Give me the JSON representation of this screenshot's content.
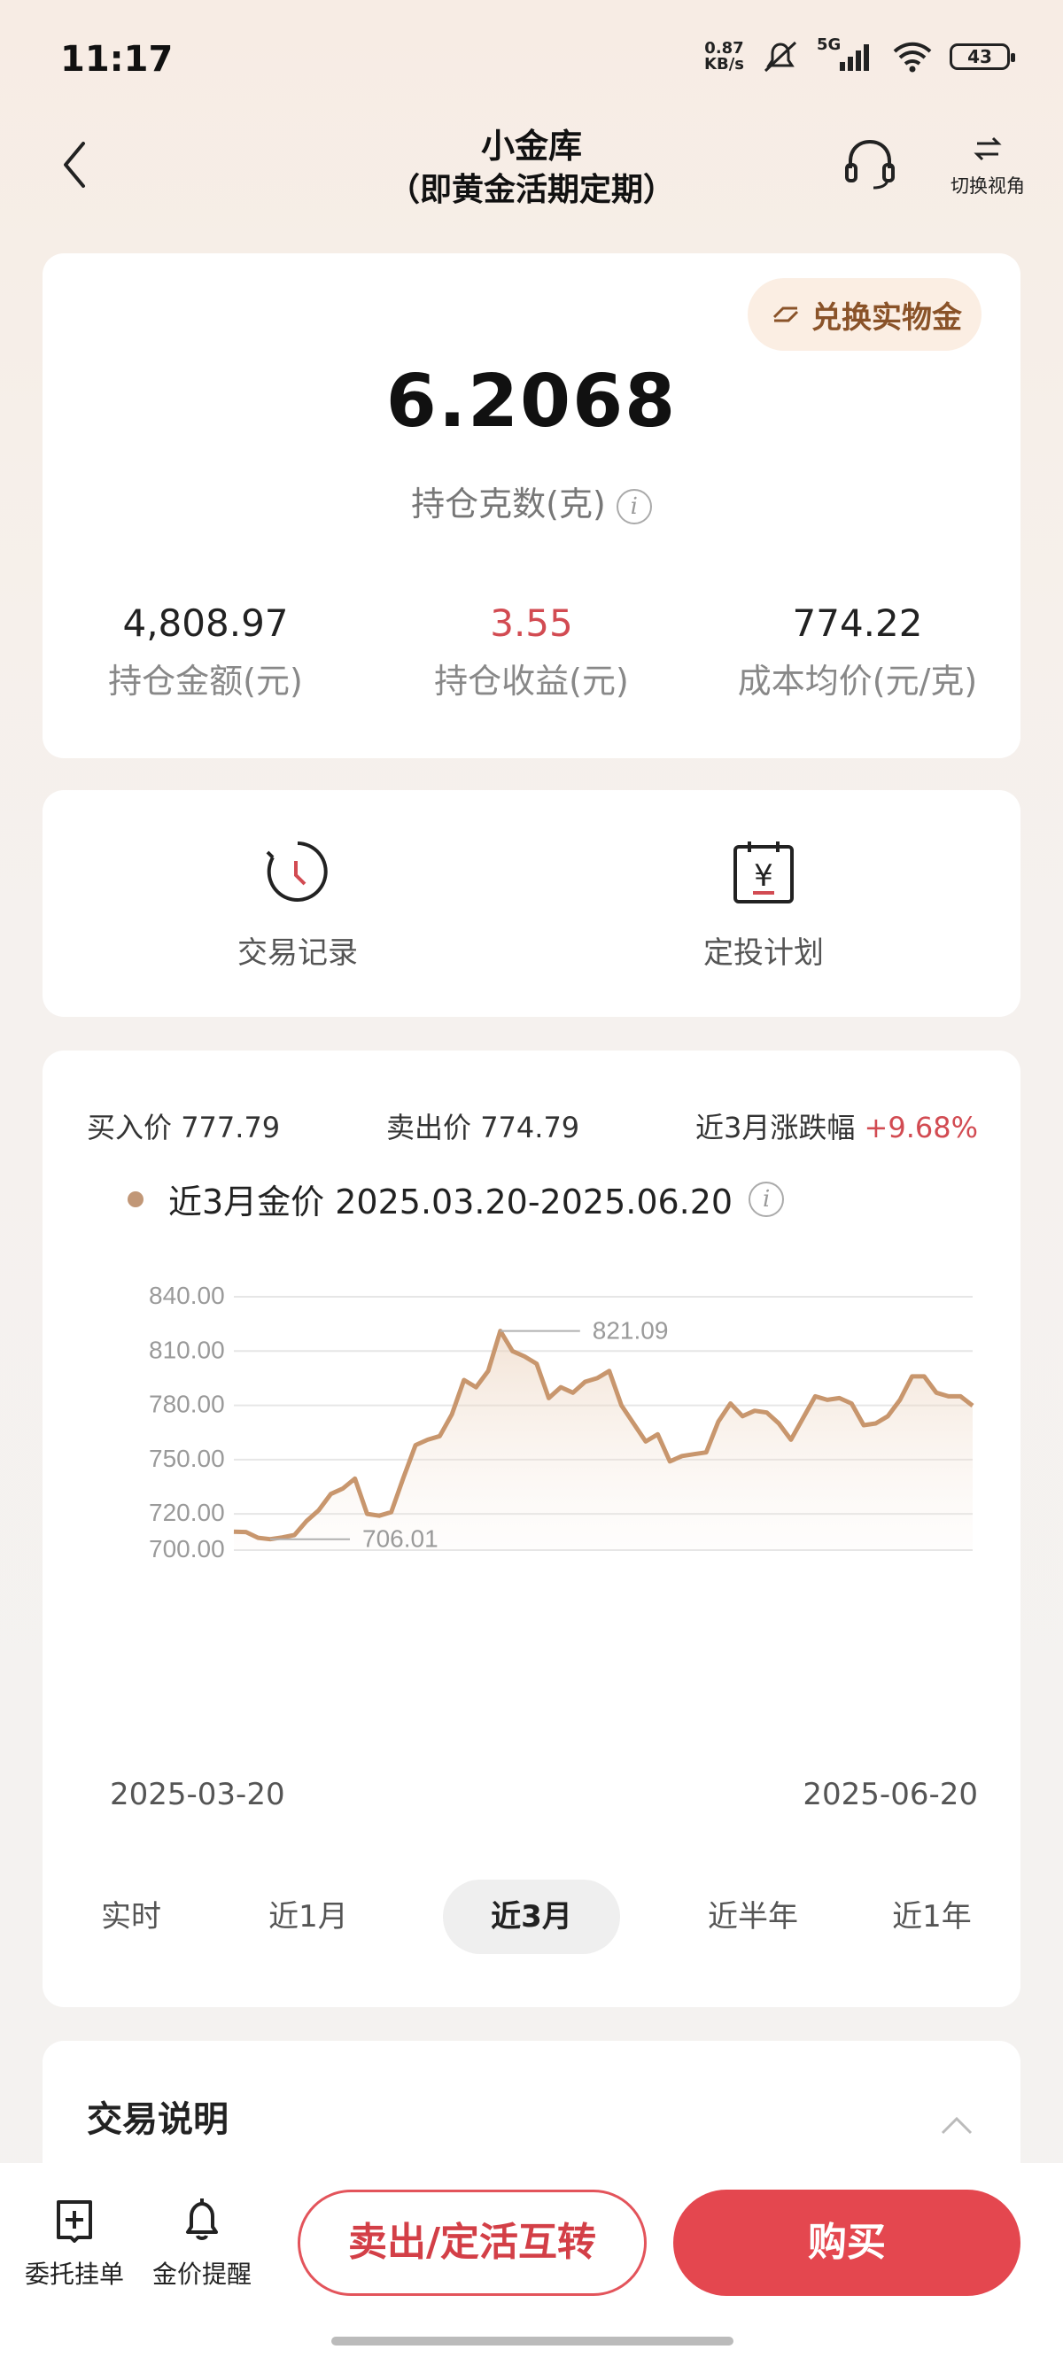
{
  "status_bar": {
    "time": "11:17",
    "net_speed_value": "0.87",
    "net_speed_unit": "KB/s",
    "network": "5G",
    "battery": "43"
  },
  "header": {
    "title": "小金库",
    "subtitle": "（即黄金活期定期）",
    "switch_view_label": "切换视角"
  },
  "holdings": {
    "exchange_button": "兑换实物金",
    "grams": "6.2068",
    "grams_label": "持仓克数(克)",
    "stats": [
      {
        "value": "4,808.97",
        "label": "持仓金额(元)"
      },
      {
        "value": "3.55",
        "label": "持仓收益(元)"
      },
      {
        "value": "774.22",
        "label": "成本均价(元/克)"
      }
    ]
  },
  "quick_actions": [
    {
      "label": "交易记录",
      "icon": "clock-history-icon"
    },
    {
      "label": "定投计划",
      "icon": "yuan-calendar-icon"
    }
  ],
  "market": {
    "buy_price_label": "买入价",
    "buy_price": "777.79",
    "sell_price_label": "卖出价",
    "sell_price": "774.79",
    "change_label": "近3月涨跌幅",
    "change_value": "+9.68%",
    "range_title": "近3月金价 2025.03.20-2025.06.20",
    "start_date": "2025-03-20",
    "end_date": "2025-06-20",
    "tabs": [
      "实时",
      "近1月",
      "近3月",
      "近半年",
      "近1年"
    ],
    "active_tab": 2
  },
  "chart_data": {
    "type": "area",
    "y_ticks": [
      "840.00",
      "810.00",
      "780.00",
      "750.00",
      "720.00",
      "700.00"
    ],
    "ylim": [
      700,
      840
    ],
    "x_range": [
      "2025-03-20",
      "2025-06-20"
    ],
    "max_label": "821.09",
    "min_label": "706.01",
    "series": [
      {
        "values": [
          710.2,
          710.0,
          706.8,
          706.0,
          707.0,
          708.3,
          716.0,
          722.0,
          731.0,
          734.0,
          739.5,
          720.0,
          719.0,
          721.0,
          740.0,
          758.0,
          761.0,
          763.0,
          775.0,
          794.0,
          790.0,
          799.0,
          821.09,
          810.0,
          807.0,
          803.0,
          784.0,
          790.0,
          787.0,
          793.0,
          795.0,
          799.0,
          780.0,
          770.0,
          760.0,
          764.0,
          749.0,
          752.0,
          753.0,
          754.0,
          771.0,
          781.0,
          774.0,
          777.0,
          776.0,
          770.0,
          761.0,
          773.0,
          785.0,
          783.0,
          784.0,
          781.0,
          769.0,
          770.0,
          774.0,
          783.0,
          796.0,
          796.0,
          787.0,
          785.0,
          785.0,
          779.79
        ],
        "color": "#c8966d"
      }
    ],
    "grid": true
  },
  "explain": {
    "title": "交易说明"
  },
  "bottom": {
    "order_label": "委托挂单",
    "alert_label": "金价提醒",
    "sell_button": "卖出/定活互转",
    "buy_button": "购买"
  }
}
